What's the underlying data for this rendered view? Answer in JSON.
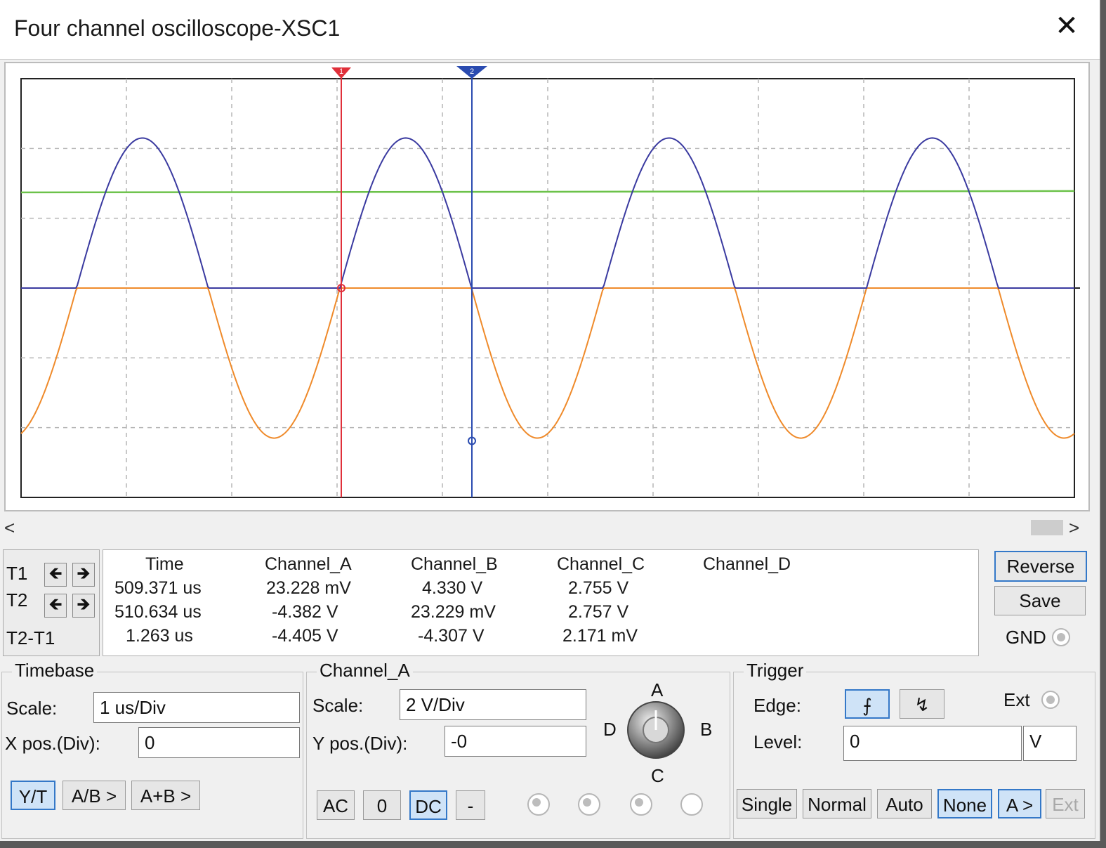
{
  "window": {
    "title": "Four channel oscilloscope-XSC1",
    "close": "✕"
  },
  "scroll": {
    "left": "<",
    "right": ">"
  },
  "cursors": {
    "t1_label": "T1",
    "t2_label": "T2",
    "dt_label": "T2-T1",
    "left_arrow": "🡸",
    "right_arrow": "🡺",
    "t1_marker": "1",
    "t2_marker": "2"
  },
  "readout": {
    "headers": [
      "Time",
      "Channel_A",
      "Channel_B",
      "Channel_C",
      "Channel_D"
    ],
    "t1": [
      "509.371 us",
      "23.228 mV",
      "4.330 V",
      "2.755 V",
      ""
    ],
    "t2": [
      "510.634 us",
      "-4.382 V",
      "23.229 mV",
      "2.757 V",
      ""
    ],
    "dt": [
      "1.263 us",
      "-4.405 V",
      "-4.307 V",
      "2.171 mV",
      ""
    ]
  },
  "side": {
    "reverse": "Reverse",
    "save": "Save",
    "gnd": "GND"
  },
  "timebase": {
    "title": "Timebase",
    "scale_label": "Scale:",
    "scale_value": "1 us/Div",
    "xpos_label": "X pos.(Div):",
    "xpos_value": "0",
    "yt": "Y/T",
    "ab": "A/B >",
    "aplusb": "A+B >"
  },
  "channel": {
    "title": "Channel_A",
    "scale_label": "Scale:",
    "scale_value": "2  V/Div",
    "ypos_label": "Y pos.(Div):",
    "ypos_value": "-0",
    "ac": "AC",
    "zero": "0",
    "dc": "DC",
    "minus": "-",
    "knob": {
      "a": "A",
      "b": "B",
      "c": "C",
      "d": "D"
    }
  },
  "trigger": {
    "title": "Trigger",
    "edge_label": "Edge:",
    "ext_label": "Ext",
    "level_label": "Level:",
    "level_value": "0",
    "level_unit": "V",
    "single": "Single",
    "normal": "Normal",
    "auto": "Auto",
    "none": "None",
    "a": "A >",
    "ext": "Ext",
    "rising_icon": "⨍",
    "falling_icon": "↯"
  },
  "colors": {
    "channel_a": "#3a3aa0",
    "channel_b": "#ef8a2a",
    "channel_c": "#6cc24a",
    "cursor_t1": "#e0303a",
    "cursor_t2": "#2a4bb0",
    "accent": "#3478c8"
  },
  "chart_data": {
    "type": "line",
    "x_divisions": 10,
    "y_divisions": 6,
    "time_per_div_us": 1,
    "volts_per_div": 2,
    "cursors_us": {
      "T1": 509.371,
      "T2": 510.634
    },
    "series": [
      {
        "channel": "A",
        "description": "positive half-wave, peak ~4.33 V, period ~2.5 us"
      },
      {
        "channel": "B",
        "description": "negative half-wave, trough ~-4.38 V, period ~2.5 us"
      },
      {
        "channel": "C",
        "description": "near-DC level ~2.76 V"
      }
    ]
  }
}
